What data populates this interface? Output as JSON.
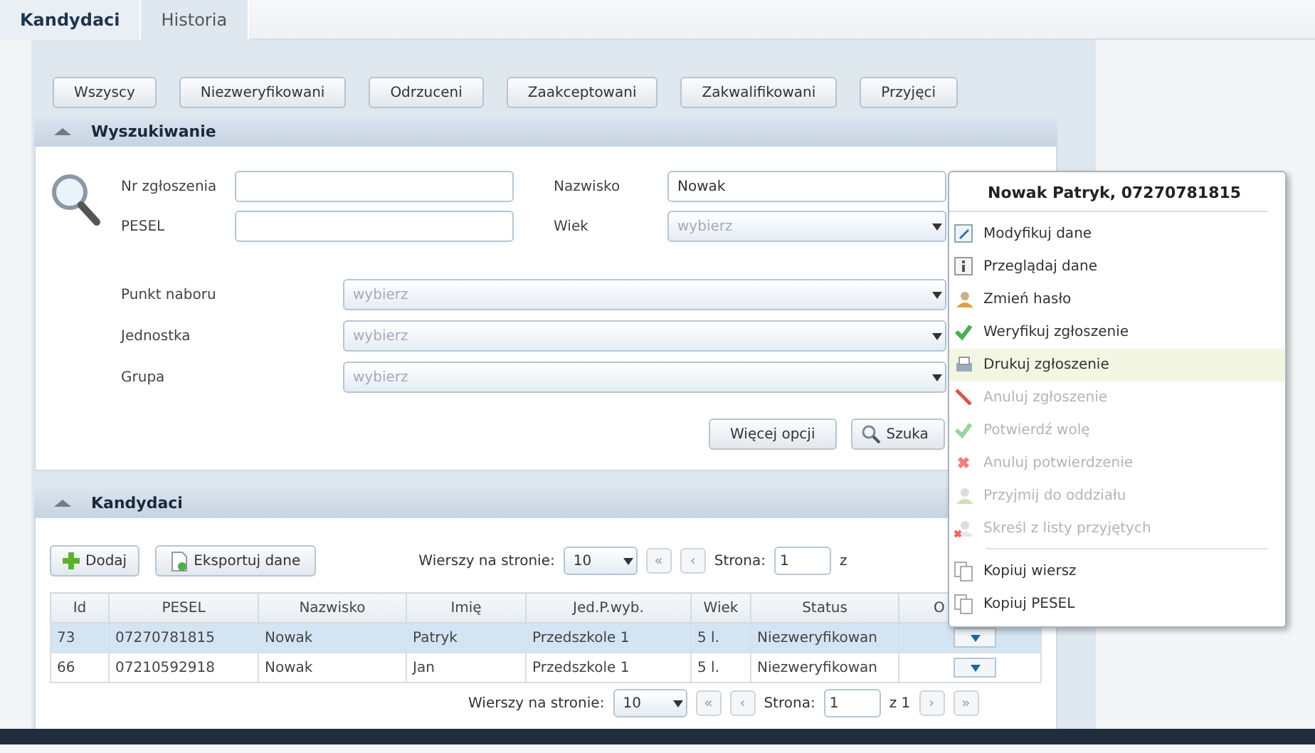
{
  "tabs": [
    {
      "label": "Kandydaci",
      "selected": true
    },
    {
      "label": "Historia",
      "selected": false
    }
  ],
  "filter_buttons": [
    "Wszyscy",
    "Niezweryfikowani",
    "Odrzuceni",
    "Zaakceptowani",
    "Zakwalifikowani",
    "Przyjęci"
  ],
  "search": {
    "title": "Wyszukiwanie",
    "fields": [
      {
        "label": "Nr zgłoszenia",
        "kind": "text"
      },
      {
        "label": "Nazwisko",
        "kind": "text",
        "value": "Nowak"
      },
      {
        "label": "PESEL",
        "kind": "text"
      },
      {
        "label": "Wiek",
        "kind": "select",
        "placeholder": "wybierz"
      }
    ],
    "selects": [
      {
        "label": "Punkt naboru",
        "placeholder": "wybierz"
      },
      {
        "label": "Jednostka",
        "placeholder": "wybierz"
      },
      {
        "label": "Grupa",
        "placeholder": "wybierz"
      }
    ],
    "buttons": [
      "Więcej opcji",
      "Szuka"
    ]
  },
  "candidates": {
    "title": "Kandydaci",
    "toolbar_buttons": [
      "Dodaj",
      "Eksportuj dane"
    ],
    "pager_top": {
      "rows_label": "Wierszy na stronie:",
      "rows_value": "10",
      "first": "«",
      "prev": "‹",
      "page_label": "Strona:",
      "page_value": "1",
      "of": "z"
    },
    "columns": [
      "Id",
      "PESEL",
      "Nazwisko",
      "Imię",
      "Jed.P.wyb.",
      "Wiek",
      "Status",
      "O"
    ],
    "rows": [
      {
        "cells": [
          "73",
          "07270781815",
          "Nowak",
          "Patryk",
          "Przedszkole 1",
          "5 l.",
          "Niezweryfikowan"
        ],
        "selected": true
      },
      {
        "cells": [
          "66",
          "07210592918",
          "Nowak",
          "Jan",
          "Przedszkole 1",
          "5 l.",
          "Niezweryfikowan"
        ],
        "selected": false
      }
    ],
    "pager_bottom": {
      "rows_label": "Wierszy na stronie:",
      "rows_value": "10",
      "first": "«",
      "prev": "‹",
      "page_label": "Strona:",
      "page_value": "1",
      "of": "z 1",
      "next": "›",
      "last": "»"
    }
  },
  "context_menu": {
    "title": "Nowak Patryk, 07270781815",
    "sections": [
      {
        "items": [
          {
            "label": "Modyfikuj dane",
            "disabled": false,
            "selected": false
          },
          {
            "label": "Przeglądaj dane",
            "disabled": false,
            "selected": false
          },
          {
            "label": "Zmień hasło",
            "disabled": false,
            "selected": false
          },
          {
            "label": "Weryfikuj zgłoszenie",
            "disabled": false,
            "selected": false
          },
          {
            "label": "Drukuj zgłoszenie",
            "disabled": false,
            "selected": true
          },
          {
            "label": "Anuluj zgłoszenie",
            "disabled": true,
            "selected": false
          },
          {
            "label": "Potwierdź wolę",
            "disabled": true,
            "selected": false
          },
          {
            "label": "Anuluj potwierdzenie",
            "disabled": true,
            "selected": false
          },
          {
            "label": "Przyjmij do oddziału",
            "disabled": true,
            "selected": false
          },
          {
            "label": "Skreśl z listy przyjętych",
            "disabled": true,
            "selected": false
          }
        ]
      },
      {
        "items": [
          {
            "label": "Kopiuj wiersz",
            "disabled": false,
            "selected": false
          },
          {
            "label": "Kopiuj PESEL",
            "disabled": false,
            "selected": false
          }
        ]
      }
    ]
  }
}
